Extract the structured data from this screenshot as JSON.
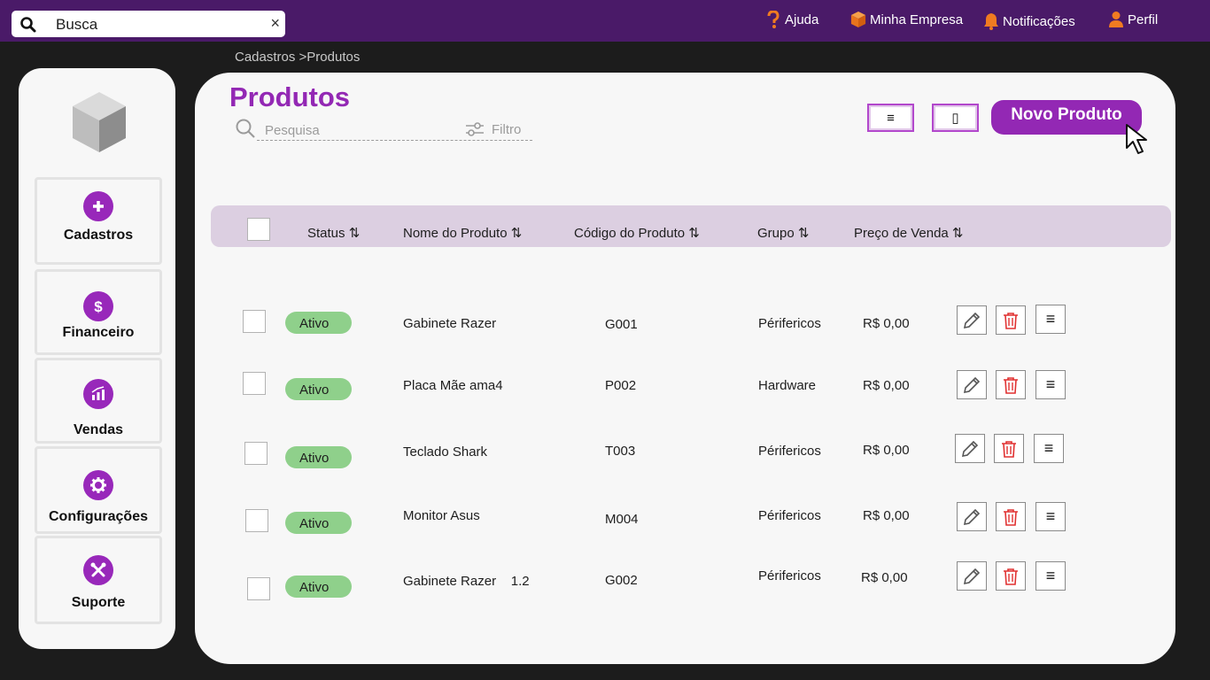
{
  "topbar": {
    "search_value": "Busca",
    "clear_symbol": "×",
    "nav": [
      {
        "label": "Ajuda",
        "icon": "help-icon"
      },
      {
        "label": "Minha Empresa",
        "icon": "box-icon"
      },
      {
        "label": "Notificações",
        "icon": "bell-icon"
      },
      {
        "label": "Perfil",
        "icon": "user-icon"
      }
    ]
  },
  "breadcrumb": "Cadastros >Produtos",
  "sidebar": {
    "items": [
      {
        "label": "Cadastros",
        "icon": "plus-icon"
      },
      {
        "label": "Financeiro",
        "icon": "dollar-icon"
      },
      {
        "label": "Vendas",
        "icon": "chart-icon"
      },
      {
        "label": "Configurações",
        "icon": "gear-icon"
      },
      {
        "label": "Suporte",
        "icon": "tools-icon"
      }
    ]
  },
  "main": {
    "title": "Produtos",
    "search_placeholder": "Pesquisa",
    "filter_label": "Filtro",
    "view_list_symbol": "≡",
    "view_grid_symbol": "▯",
    "new_button": "Novo Produto"
  },
  "table": {
    "columns": [
      "Status ⇅",
      "Nome do Produto ⇅",
      "Código do Produto ⇅",
      "Grupo  ⇅",
      "Preço de Venda ⇅"
    ],
    "menu_symbol": "≡",
    "rows": [
      {
        "status": "Ativo",
        "name": "Gabinete Razer",
        "code": "G001",
        "group": "Périfericos",
        "price": "R$ 0,00"
      },
      {
        "status": "Ativo",
        "name": "Placa Mãe ama4",
        "code": "P002",
        "group": "Hardware",
        "price": "R$ 0,00"
      },
      {
        "status": "Ativo",
        "name": "Teclado Shark",
        "code": "T003",
        "group": "Périfericos",
        "price": "R$ 0,00"
      },
      {
        "status": "Ativo",
        "name": "Monitor Asus",
        "code": "M004",
        "group": "Périfericos",
        "price": "R$ 0,00"
      },
      {
        "status": "Ativo",
        "name": "Gabinete Razer    1.2",
        "code": "G002",
        "group": "Périfericos",
        "price": "R$ 0,00"
      }
    ]
  },
  "colors": {
    "topbar": "#4a1a68",
    "accent": "#9328b4",
    "badge": "#8fd08b",
    "table_header": "#dccfe1"
  }
}
